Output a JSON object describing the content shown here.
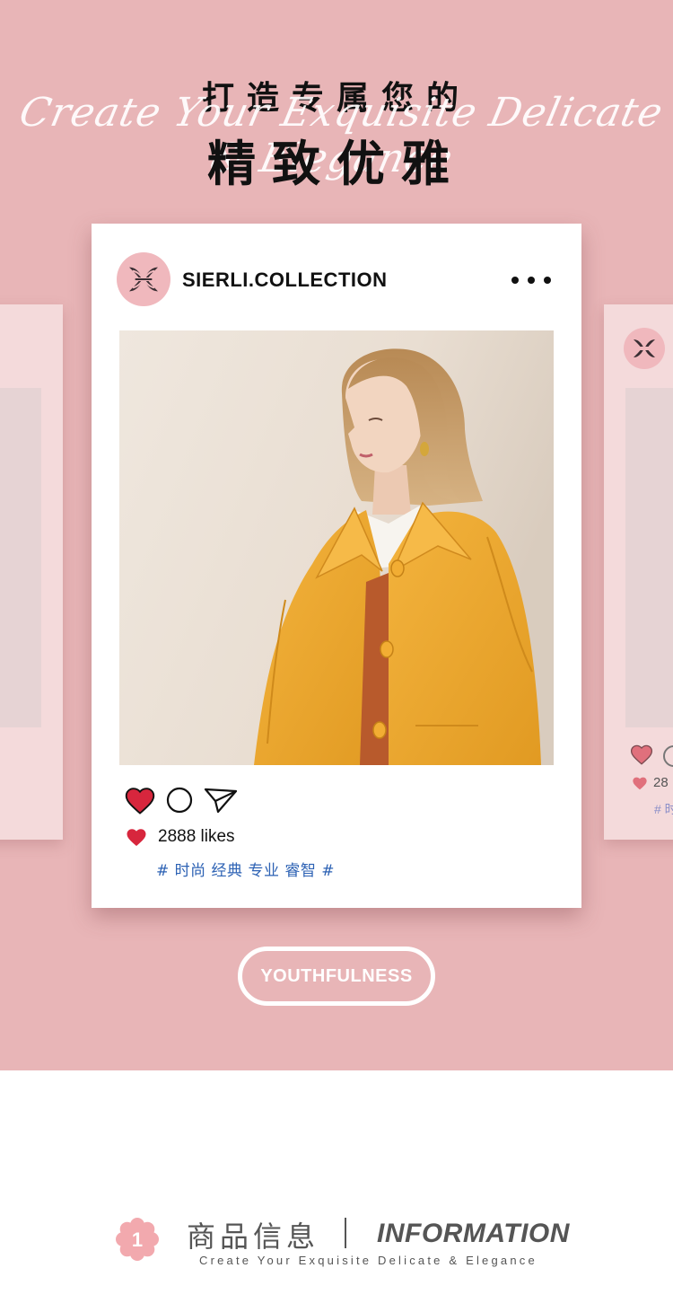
{
  "hero": {
    "title_top": "打造专属您的",
    "script_line": "Create Your Exquisite Delicate & Elegance",
    "title_main": "精致优雅",
    "background_color": "#e8b5b7"
  },
  "post": {
    "account_name": "SIERLI.COLLECTION",
    "more_icon": "more-dots-icon",
    "like_icon": "heart-icon",
    "comment_icon": "comment-circle-icon",
    "share_icon": "send-icon",
    "likes_text": "2888 likes",
    "hashtags": "# 时尚 经典 专业 睿智 #",
    "heart_color": "#d7263d",
    "hashtag_color": "#2d62b4"
  },
  "side_card_right": {
    "likes_text": "28",
    "tag_text": "# 时"
  },
  "cta": {
    "label": "YOUTHFULNESS"
  },
  "info": {
    "number": "1",
    "title_cn": "商品信息",
    "title_en": "INFORMATION",
    "subtitle": "Create Your Exquisite Delicate & Elegance"
  }
}
